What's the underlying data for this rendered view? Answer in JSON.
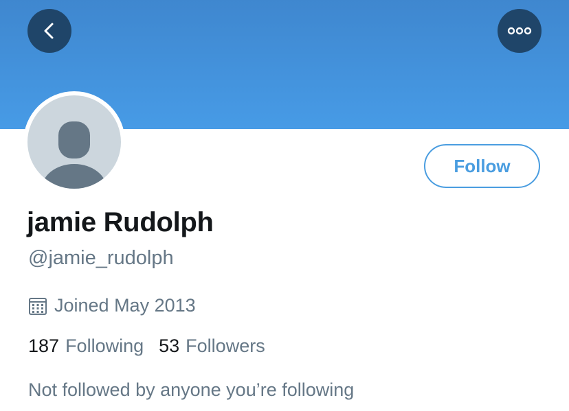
{
  "header": {
    "back_icon": "chevron-left-icon",
    "more_icon": "ellipsis-icon"
  },
  "profile": {
    "display_name": "jamie Rudolph",
    "handle": "@jamie_rudolph",
    "joined": "Joined May 2013",
    "follow_label": "Follow",
    "following_count": "187",
    "following_label": "Following",
    "followers_count": "53",
    "followers_label": "Followers",
    "not_followed_text": "Not followed by anyone you’re following"
  },
  "colors": {
    "banner": "#4594df",
    "accent": "#4a9de0",
    "secondary_text": "#657786",
    "primary_text": "#14171a",
    "button_dark": "#1f4569"
  }
}
